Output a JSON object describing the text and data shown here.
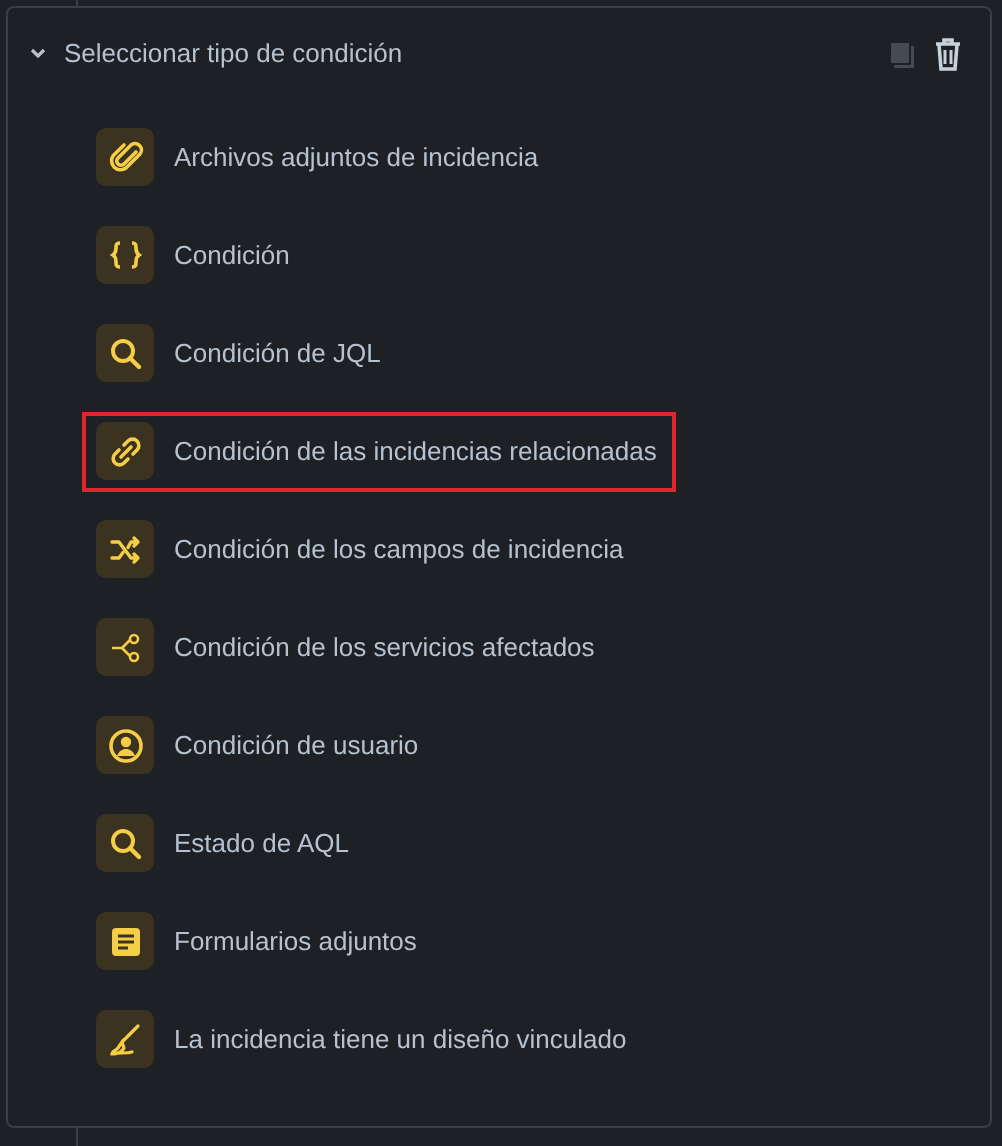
{
  "panel": {
    "title": "Seleccionar tipo de condición",
    "expanded": true
  },
  "items": [
    {
      "kind": "attachment",
      "label": "Archivos adjuntos de incidencia",
      "highlighted": false
    },
    {
      "kind": "braces",
      "label": "Condición",
      "highlighted": false
    },
    {
      "kind": "search",
      "label": "Condición de JQL",
      "highlighted": false
    },
    {
      "kind": "link",
      "label": "Condición de las incidencias relacionadas",
      "highlighted": true
    },
    {
      "kind": "shuffle",
      "label": "Condición de los campos de incidencia",
      "highlighted": false
    },
    {
      "kind": "branch",
      "label": "Condición de los servicios afectados",
      "highlighted": false
    },
    {
      "kind": "user",
      "label": "Condición de usuario",
      "highlighted": false
    },
    {
      "kind": "search",
      "label": "Estado de AQL",
      "highlighted": false
    },
    {
      "kind": "form",
      "label": "Formularios adjuntos",
      "highlighted": false
    },
    {
      "kind": "brush",
      "label": "La incidencia tiene un diseño vinculado",
      "highlighted": false
    }
  ]
}
